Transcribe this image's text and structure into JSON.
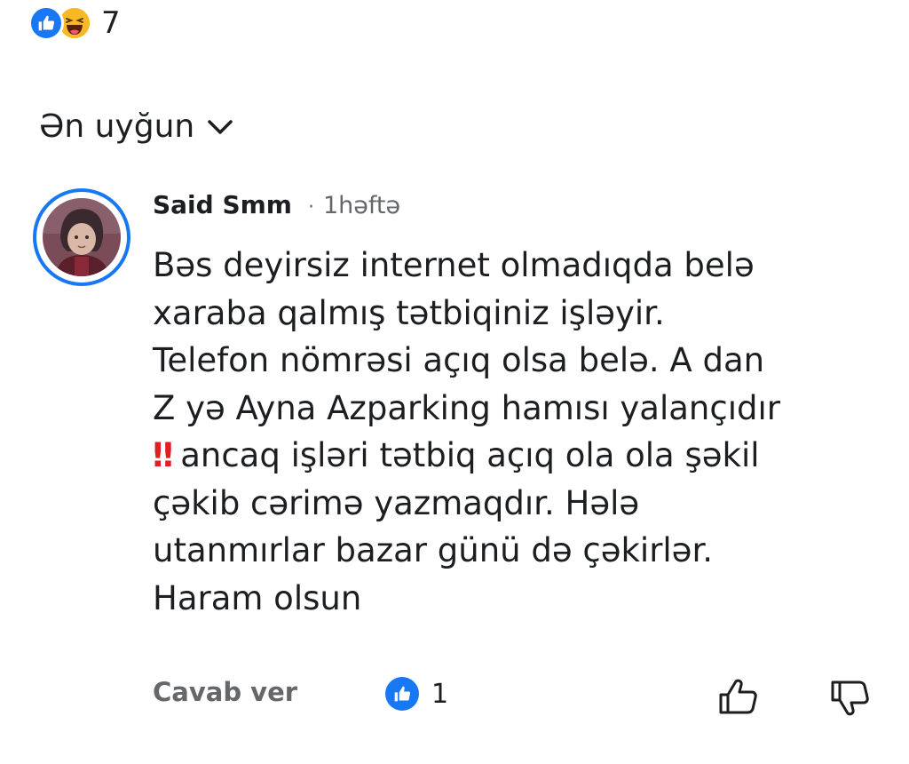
{
  "reactions": {
    "count": "7",
    "types": [
      "like-icon",
      "haha-icon"
    ]
  },
  "sort": {
    "label": "Ən uyğun"
  },
  "comment": {
    "author": "Said Smm",
    "separator": "·",
    "time": "1həftə",
    "lines_before_emoji": "Bəs deyirsiz internet olmadıqda belə\nxaraba qalmış tətbiqiniz işləyir.\nTelefon nömrəsi açıq olsa belə. A dan\nZ yə Ayna Azparking hamısı yalançıdır",
    "emoji": "‼",
    "lines_after_emoji": "ancaq işləri tətbiq açıq ola ola şəkil\nçəkib cərimə yazmaqdır. Hələ\nutanmırlar bazar günü də çəkirlər.\nHaram olsun"
  },
  "actions": {
    "reply_label": "Cavab ver",
    "like_count": "1"
  },
  "colors": {
    "accent": "#1877f2",
    "haha": "#f7b928",
    "secondary_text": "#65676b",
    "emoji_red": "#e02020"
  }
}
